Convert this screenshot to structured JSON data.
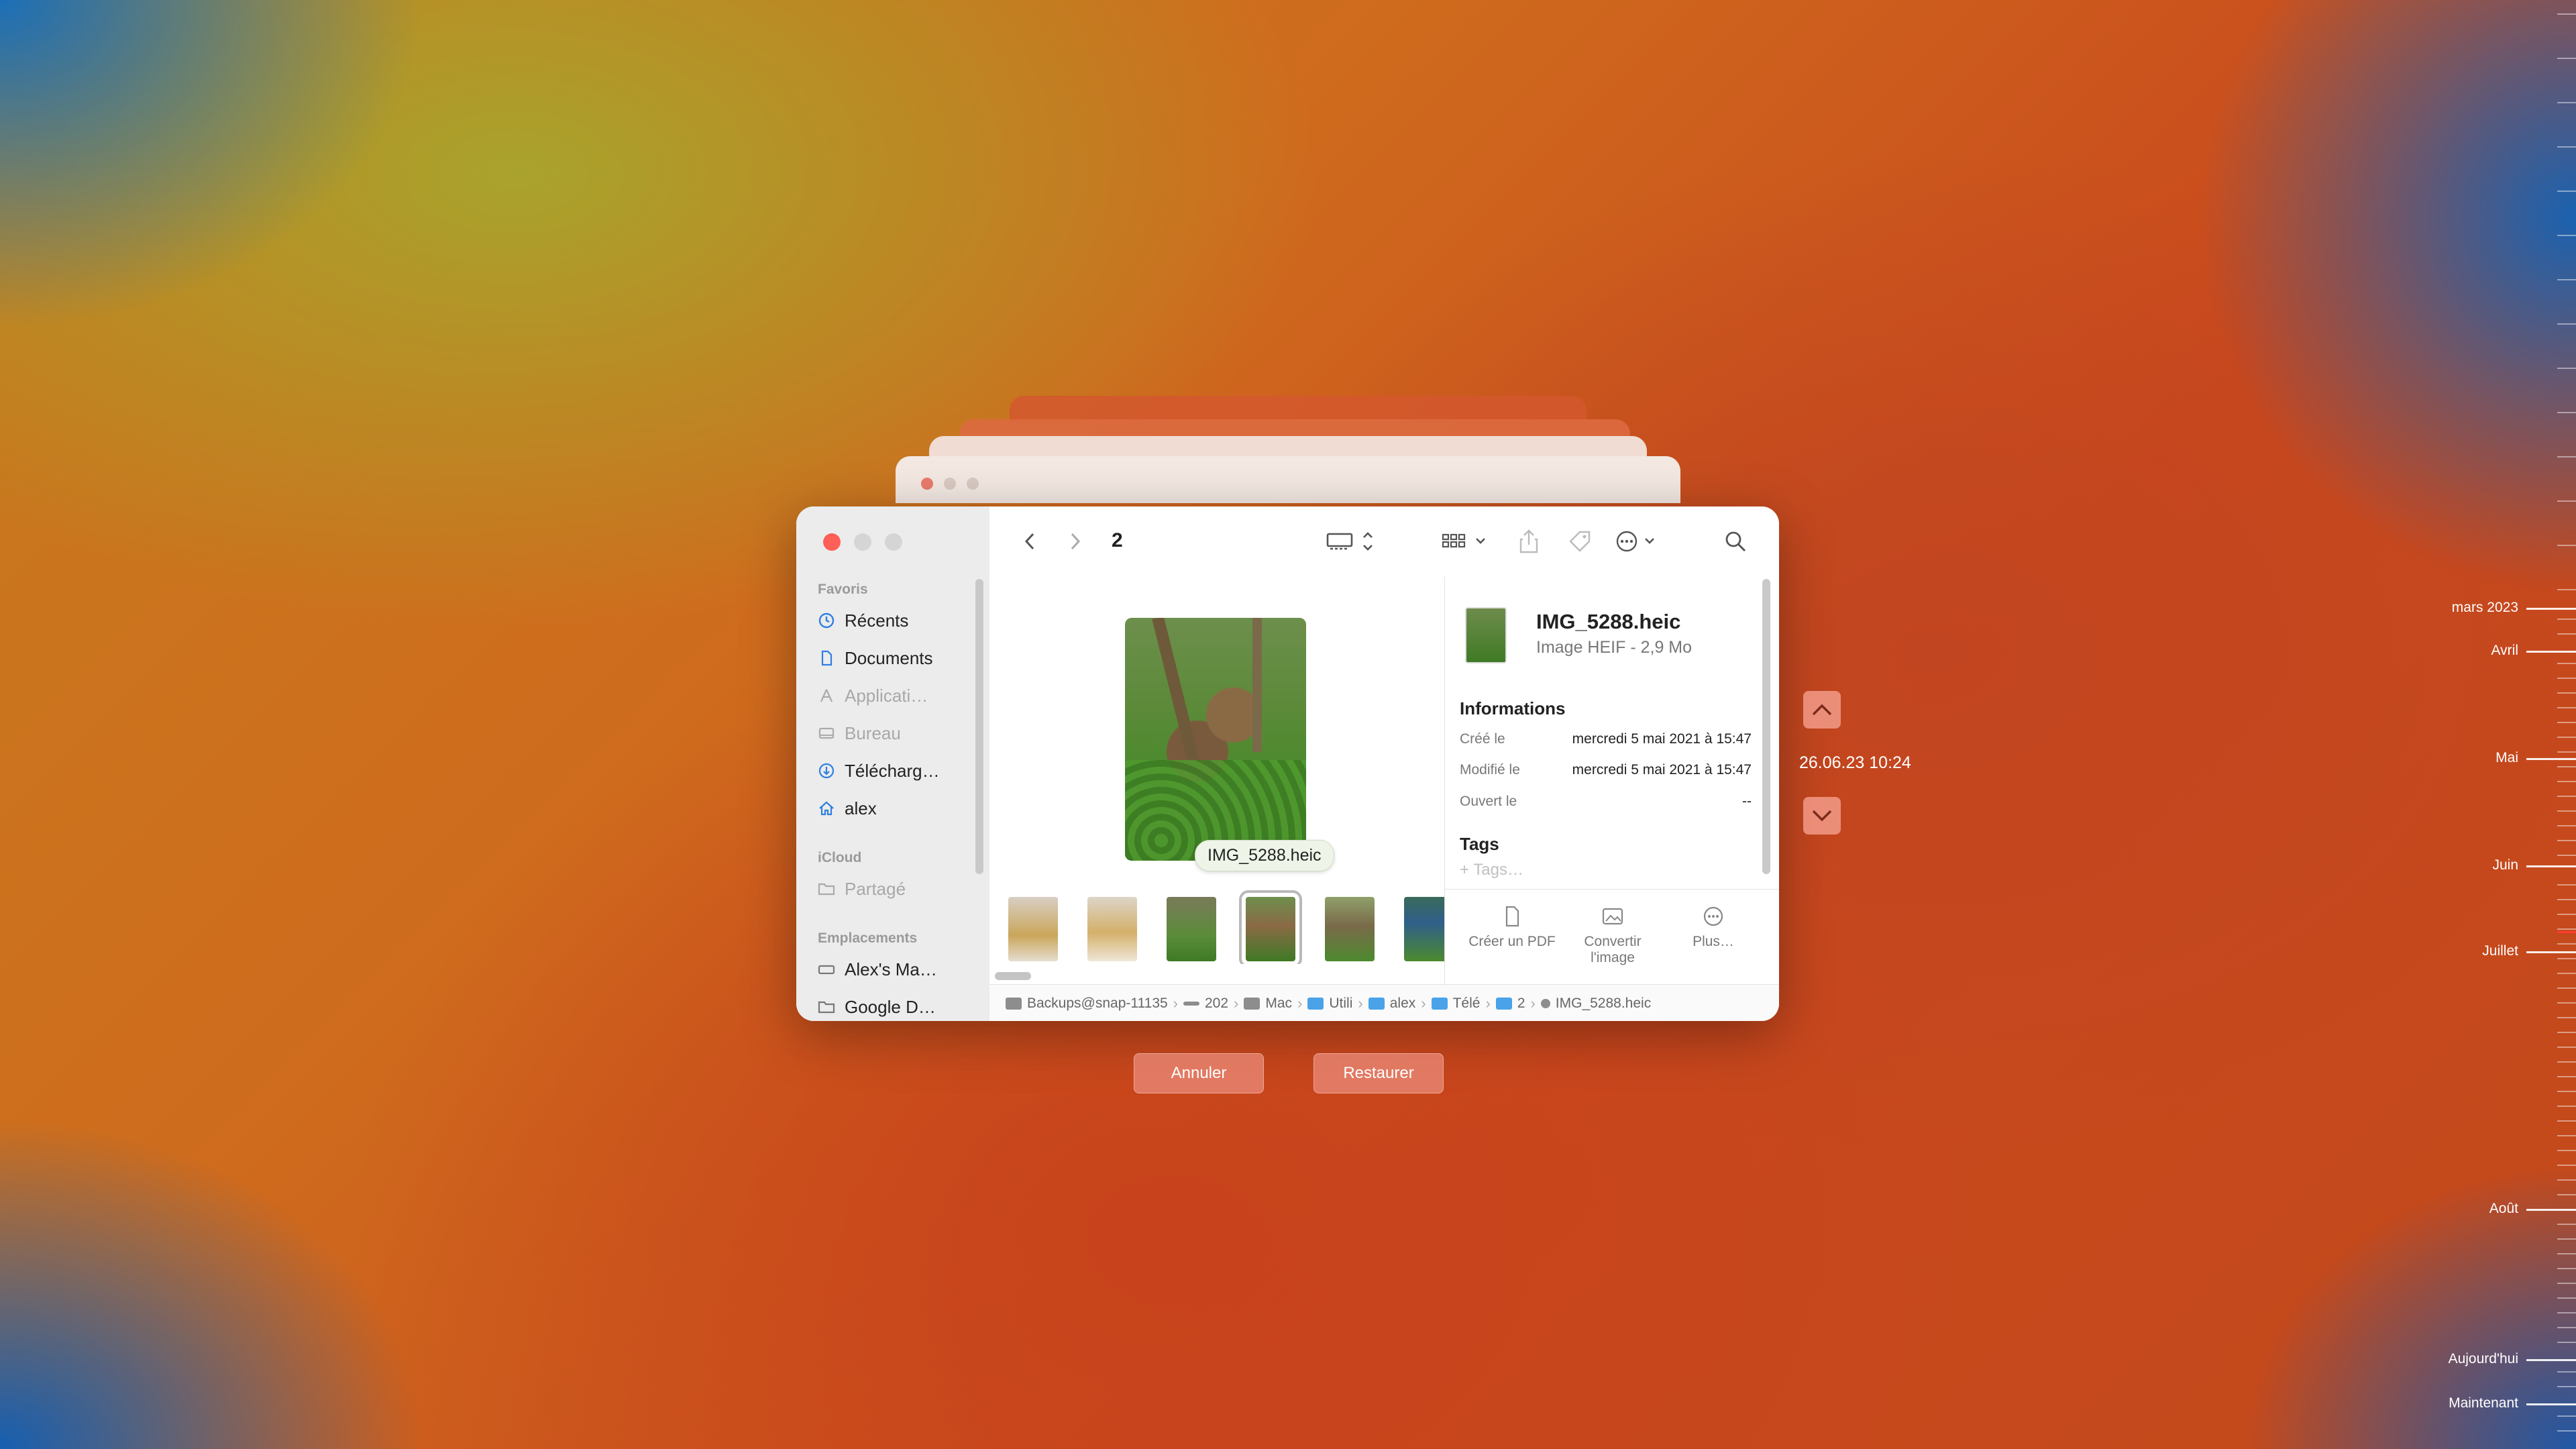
{
  "finder": {
    "folder_title": "2",
    "sidebar": {
      "favorites_heading": "Favoris",
      "favorites": [
        {
          "label": "Récents",
          "icon": "clock-icon"
        },
        {
          "label": "Documents",
          "icon": "document-icon"
        },
        {
          "label": "Applicati…",
          "icon": "apps-icon"
        },
        {
          "label": "Bureau",
          "icon": "desktop-icon"
        },
        {
          "label": "Télécharg…",
          "icon": "download-icon"
        },
        {
          "label": "alex",
          "icon": "home-icon"
        }
      ],
      "icloud_heading": "iCloud",
      "icloud": [
        {
          "label": "Partagé",
          "icon": "shared-folder-icon"
        }
      ],
      "locations_heading": "Emplacements",
      "locations": [
        {
          "label": "Alex's Ma…",
          "icon": "disk-icon"
        },
        {
          "label": "Google D…",
          "icon": "folder-icon"
        }
      ]
    },
    "tooltip": "IMG_5288.heic",
    "info": {
      "file_name": "IMG_5288.heic",
      "file_type": "Image HEIF - 2,9 Mo",
      "informations_heading": "Informations",
      "rows": [
        {
          "label": "Créé le",
          "value": "mercredi 5 mai 2021 à 15:47"
        },
        {
          "label": "Modifié le",
          "value": "mercredi 5 mai 2021 à 15:47"
        },
        {
          "label": "Ouvert le",
          "value": "--"
        }
      ],
      "tags_heading": "Tags",
      "tags_placeholder": "+ Tags…",
      "actions": [
        {
          "label": "Créer un PDF",
          "icon": "pdf-icon"
        },
        {
          "label": "Convertir l'image",
          "icon": "convert-image-icon"
        },
        {
          "label": "Plus…",
          "icon": "more-icon"
        }
      ]
    },
    "pathbar": [
      "Backups@snap-11135",
      "202",
      "Mac",
      "Utili",
      "alex",
      "Télé",
      "2",
      "IMG_5288.heic"
    ]
  },
  "buttons": {
    "cancel": "Annuler",
    "restore": "Restaurer"
  },
  "snapshot_date": "26.06.23 10:24",
  "timeline": {
    "labels": [
      "mars 2023",
      "Avril",
      "Mai",
      "Juin",
      "Juillet",
      "Août",
      "Aujourd'hui",
      "Maintenant"
    ]
  },
  "colors": {
    "close_button": "#fe5f57",
    "folder_icon": "#4aa2e8",
    "action_button": "#e6826e"
  }
}
